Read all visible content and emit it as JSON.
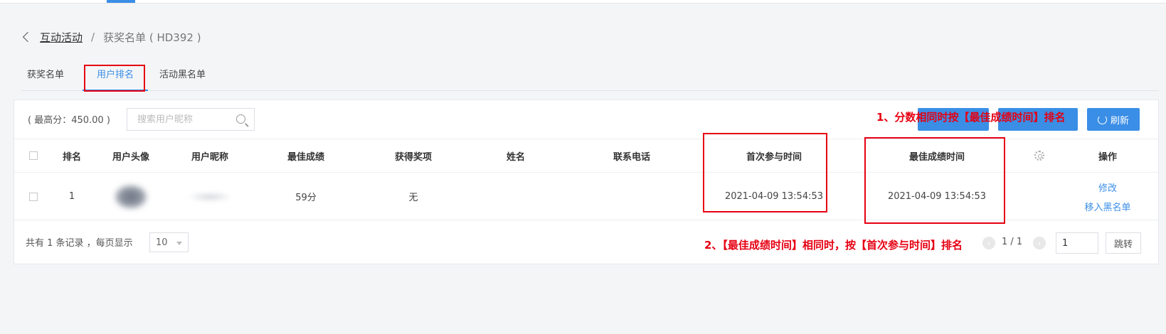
{
  "breadcrumb": {
    "parent": "互动活动",
    "separator": "/",
    "current": "获奖名单 ( HD392 )"
  },
  "tabs": [
    {
      "label": "获奖名单",
      "active": false
    },
    {
      "label": "用户排名",
      "active": true
    },
    {
      "label": "活动黑名单",
      "active": false
    }
  ],
  "toolbar": {
    "max_score": "( 最高分：450.00 )",
    "search_placeholder": "搜索用户昵称",
    "refresh_label": "刷新"
  },
  "annotations": {
    "note1": "1、分数相同时按【最佳成绩时间】排名",
    "note2": "2、【最佳成绩时间】相同时，按【首次参与时间】排名"
  },
  "table": {
    "headers": {
      "rank": "排名",
      "avatar": "用户头像",
      "nickname": "用户昵称",
      "best_score": "最佳成绩",
      "prize": "获得奖项",
      "name": "姓名",
      "phone": "联系电话",
      "first_time": "首次参与时间",
      "best_time": "最佳成绩时间",
      "ops": "操作"
    },
    "rows": [
      {
        "rank": "1",
        "best_score": "59分",
        "prize": "无",
        "name": "",
        "phone": "",
        "first_time": "2021-04-09 13:54:53",
        "best_time": "2021-04-09 13:54:53",
        "op_edit": "修改",
        "op_blacklist": "移入黑名单"
      }
    ]
  },
  "pagination": {
    "total_text": "共有 1 条记录 ，每页显示",
    "page_size": "10",
    "page_info": "1 / 1",
    "page_input": "1",
    "go_label": "跳转"
  },
  "colors": {
    "accent": "#3a8ee6",
    "annotation": "#e60012"
  }
}
